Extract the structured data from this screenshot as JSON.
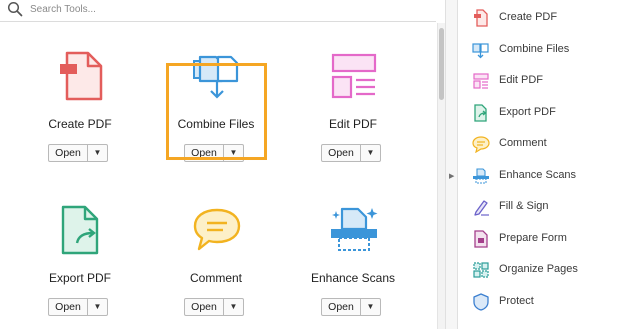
{
  "search": {
    "placeholder": "Search Tools..."
  },
  "tools": [
    {
      "label": "Create PDF",
      "button": "Open",
      "icon": "create-pdf-icon",
      "color": "#e35d5b"
    },
    {
      "label": "Combine Files",
      "button": "Open",
      "icon": "combine-files-icon",
      "color": "#3b95d9",
      "highlighted": true
    },
    {
      "label": "Edit PDF",
      "button": "Open",
      "icon": "edit-pdf-icon",
      "color": "#e469c9"
    },
    {
      "label": "Export PDF",
      "button": "Open",
      "icon": "export-pdf-icon",
      "color": "#2fa57a"
    },
    {
      "label": "Comment",
      "button": "Open",
      "icon": "comment-icon",
      "color": "#f2b320"
    },
    {
      "label": "Enhance Scans",
      "button": "Open",
      "icon": "enhance-scans-icon",
      "color": "#3b95d9"
    }
  ],
  "highlight_color": "#f5a623",
  "panel": {
    "items": [
      {
        "label": "Create PDF",
        "icon": "create-pdf-icon"
      },
      {
        "label": "Combine Files",
        "icon": "combine-files-icon"
      },
      {
        "label": "Edit PDF",
        "icon": "edit-pdf-icon"
      },
      {
        "label": "Export PDF",
        "icon": "export-pdf-icon"
      },
      {
        "label": "Comment",
        "icon": "comment-icon"
      },
      {
        "label": "Enhance Scans",
        "icon": "enhance-scans-icon"
      },
      {
        "label": "Fill & Sign",
        "icon": "fill-sign-icon"
      },
      {
        "label": "Prepare Form",
        "icon": "prepare-form-icon"
      },
      {
        "label": "Organize Pages",
        "icon": "organize-pages-icon"
      },
      {
        "label": "Protect",
        "icon": "protect-icon"
      }
    ]
  }
}
